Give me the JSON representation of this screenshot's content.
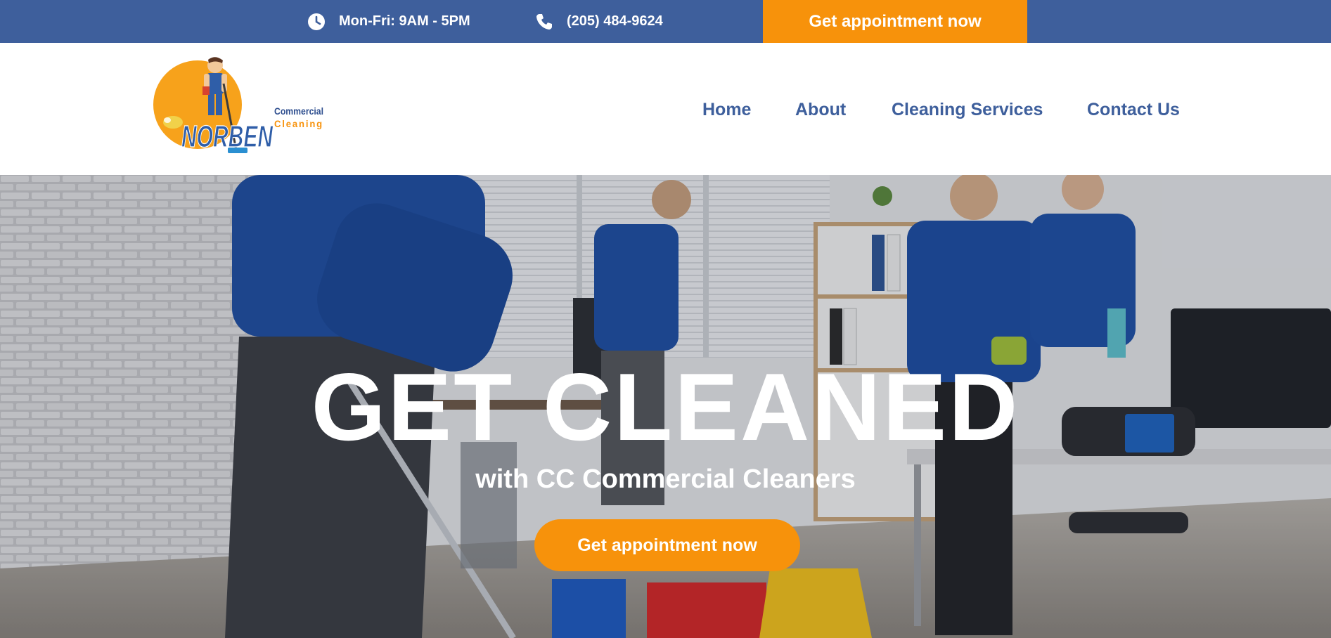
{
  "topbar": {
    "hours_icon": "clock-icon",
    "hours": "Mon-Fri: 9AM - 5PM",
    "phone_icon": "phone-icon",
    "phone": "(205) 484-9624",
    "cta": "Get appointment now"
  },
  "logo": {
    "brand": "NORBEN",
    "line1": "Commercial",
    "line2": "Cleaning"
  },
  "nav": [
    "Home",
    "About",
    "Cleaning Services",
    "Contact Us"
  ],
  "hero": {
    "title": "GET CLEANED",
    "subtitle": "with CC Commercial Cleaners",
    "cta": "Get appointment now"
  },
  "colors": {
    "brand_blue": "#3e5f9c",
    "accent_orange": "#f7920b",
    "white": "#ffffff"
  }
}
